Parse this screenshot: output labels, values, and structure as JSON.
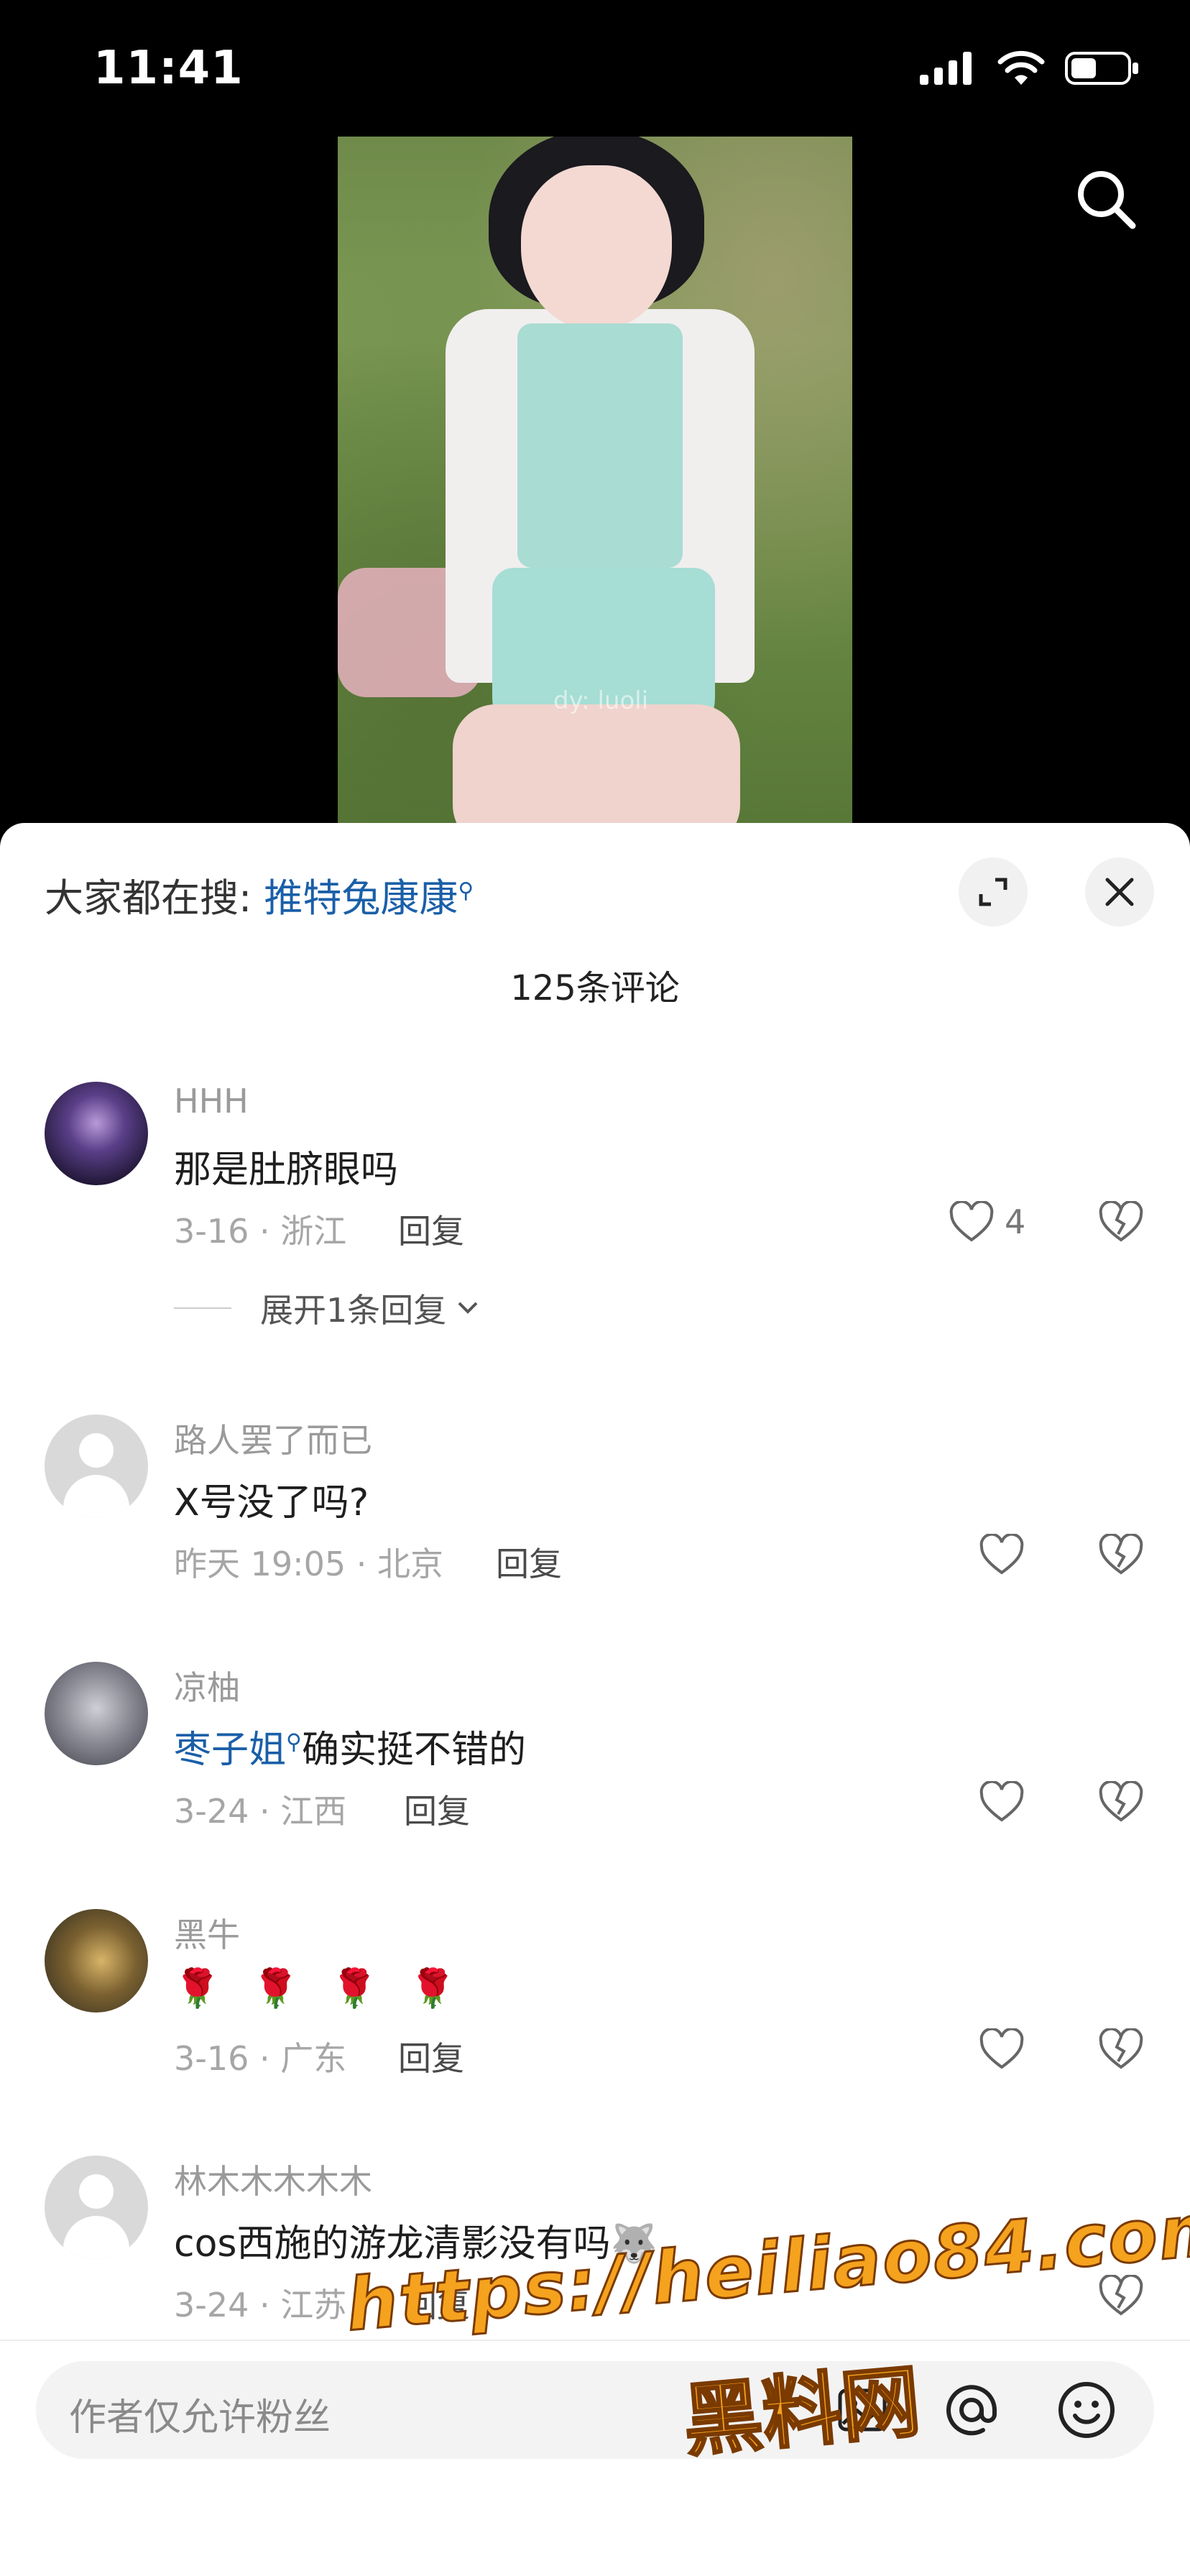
{
  "status_bar": {
    "time": "11:41"
  },
  "video": {
    "watermark": "dy: luoli"
  },
  "hot_search": {
    "prefix": "大家都在搜: ",
    "query": "推特兔康康"
  },
  "comments_count": "125条评论",
  "comments": [
    {
      "user": "HHH",
      "text": "那是肚脐眼吗",
      "date_location": "3-16 · 浙江",
      "reply": "回复",
      "likes": "4",
      "expand": "展开1条回复"
    },
    {
      "user": "路人罢了而已",
      "text": "X号没了吗?",
      "date_location": "昨天 19:05 · 北京",
      "reply": "回复"
    },
    {
      "user": "凉柚",
      "link": "枣子姐",
      "text": "确实挺不错的",
      "date_location": "3-24 · 江西",
      "reply": "回复"
    },
    {
      "user": "黑牛",
      "text": "🌹 🌹 🌹 🌹",
      "date_location": "3-16 · 广东",
      "reply": "回复"
    },
    {
      "user": "林木木木木木",
      "text": "cos西施的游龙清影没有吗🐺",
      "date_location": "3-24 · 江苏",
      "reply": "回复"
    }
  ],
  "input": {
    "placeholder": "作者仅允许粉丝"
  },
  "overlay": {
    "url": "https://heiliao84.com",
    "brand": "黑料网"
  },
  "icons": {
    "search": "search-icon",
    "expand": "expand-icon",
    "close": "close-icon",
    "like": "heart-icon",
    "dislike": "broken-heart-icon",
    "mention": "at-icon",
    "emoji": "emoji-icon",
    "image": "image-icon"
  }
}
